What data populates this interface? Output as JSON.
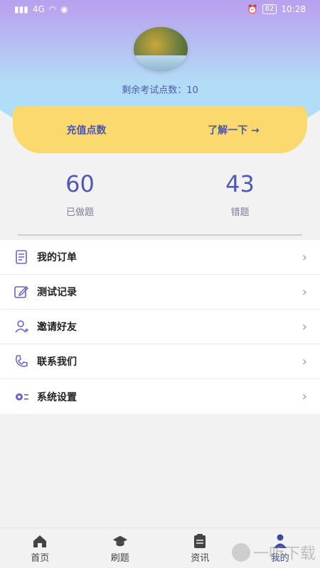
{
  "status": {
    "left": "4G",
    "time": "10:28",
    "battery": "82"
  },
  "header": {
    "points_text": "剩余考试点数：10"
  },
  "recharge": {
    "left_label": "充值点数",
    "right_label": "了解一下 →"
  },
  "stats": [
    {
      "value": "60",
      "label": "已做题"
    },
    {
      "value": "43",
      "label": "错题"
    }
  ],
  "menu": [
    {
      "label": "我的订单",
      "icon": "order-list-icon"
    },
    {
      "label": "测试记录",
      "icon": "edit-record-icon"
    },
    {
      "label": "邀请好友",
      "icon": "invite-user-icon"
    },
    {
      "label": "联系我们",
      "icon": "phone-icon"
    },
    {
      "label": "系统设置",
      "icon": "settings-icon"
    }
  ],
  "tabs": [
    {
      "label": "首页",
      "icon": "home-icon"
    },
    {
      "label": "刷题",
      "icon": "graduation-cap-icon"
    },
    {
      "label": "资讯",
      "icon": "clipboard-icon"
    },
    {
      "label": "我的",
      "icon": "profile-icon",
      "active": true
    }
  ],
  "watermark": "一听下载",
  "colors": {
    "accent": "#4d59b2",
    "card": "#fbd96e",
    "header_top": "#a77dec",
    "header_bottom": "#a9e1fb"
  }
}
